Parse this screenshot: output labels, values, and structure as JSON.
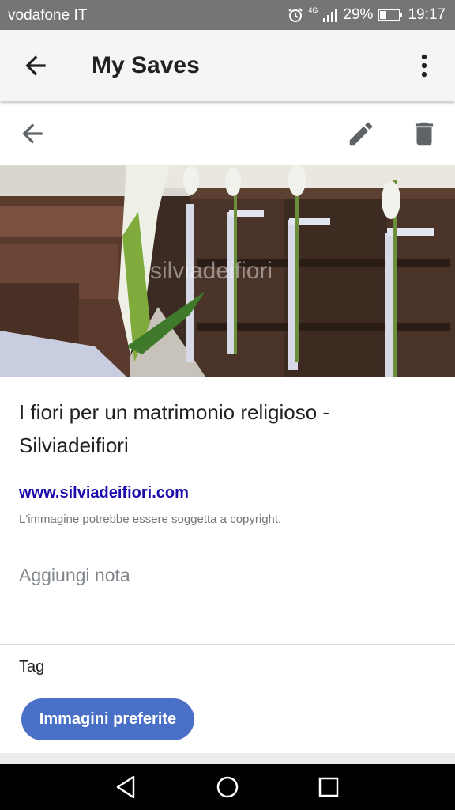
{
  "status_bar": {
    "carrier": "vodafone IT",
    "network": "4G",
    "battery_percent": "29%",
    "time": "19:17",
    "icons": [
      "alarm-icon",
      "signal-icon",
      "battery-icon"
    ]
  },
  "app_bar": {
    "title": "My Saves",
    "icons": [
      "back-arrow-icon",
      "more-vert-icon"
    ]
  },
  "toolbar": {
    "icons": [
      "back-arrow-icon",
      "edit-pencil-icon",
      "delete-trash-icon"
    ]
  },
  "hero_image": {
    "watermark": "silviadeifiori"
  },
  "save": {
    "title": "I fiori per un matrimonio religioso - Silviadeifiori",
    "url": "www.silviadeifiori.com",
    "copyright_notice": "L'immagine potrebbe essere soggetta a copyright."
  },
  "note": {
    "placeholder": "Aggiungi nota"
  },
  "tags": {
    "label": "Tag",
    "items": [
      "Immagini preferite"
    ]
  },
  "nav_bar": {
    "icons": [
      "nav-back-icon",
      "nav-home-icon",
      "nav-recents-icon"
    ]
  },
  "colors": {
    "status_bar": "#757575",
    "app_bar": "#f5f5f5",
    "link": "#1a0dab",
    "chip": "#4a6fc7"
  }
}
